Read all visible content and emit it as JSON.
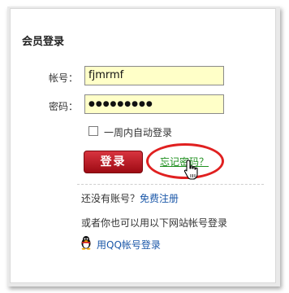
{
  "login": {
    "title": "会员登录",
    "account_label": "帐号：",
    "account_value": "fjmrmf",
    "password_label": "密码：",
    "password_value": "●●●●●●●●●",
    "remember_label": "一周内自动登录",
    "login_button": "登录",
    "forgot_link": "忘记密码？"
  },
  "register": {
    "prompt": "还没有账号？",
    "link": "免费注册"
  },
  "alt_login": {
    "text": "或者你也可以用以下网站帐号登录",
    "qq_link": "用QQ帐号登录"
  },
  "colors": {
    "input_bg": "#ffffc8",
    "login_button": "#b01018",
    "highlight_ellipse": "#e02020",
    "forgot_link": "#1e8f1e",
    "link": "#1a57a8"
  },
  "icons": [
    "checkbox-icon",
    "hand-cursor-icon",
    "qq-penguin-icon"
  ]
}
